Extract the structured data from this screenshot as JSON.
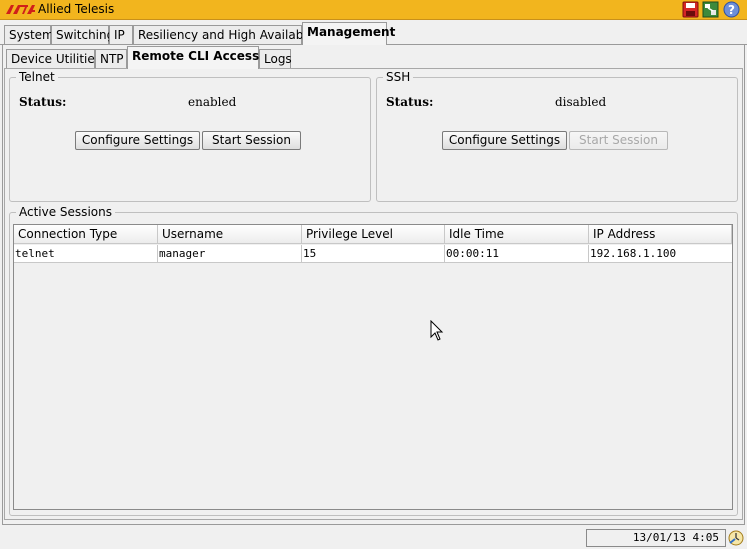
{
  "app": {
    "title": "Allied Telesis",
    "logo_text": "AT"
  },
  "main_tabs": [
    {
      "label": "System"
    },
    {
      "label": "Switching"
    },
    {
      "label": "IP"
    },
    {
      "label": "Resiliency and High Availability"
    },
    {
      "label": "Management"
    }
  ],
  "sub_tabs": [
    {
      "label": "Device Utilities"
    },
    {
      "label": "NTP"
    },
    {
      "label": "Remote CLI Access"
    },
    {
      "label": "Logs"
    }
  ],
  "telnet": {
    "title": "Telnet",
    "status_label": "Status:",
    "status_value": "enabled",
    "configure_label": "Configure Settings",
    "start_label": "Start Session"
  },
  "ssh": {
    "title": "SSH",
    "status_label": "Status:",
    "status_value": "disabled",
    "configure_label": "Configure Settings",
    "start_label": "Start Session"
  },
  "sessions": {
    "title": "Active Sessions",
    "columns": [
      "Connection Type",
      "Username",
      "Privilege Level",
      "Idle Time",
      "IP Address"
    ],
    "rows": [
      [
        "telnet",
        "manager",
        "15",
        "00:00:11",
        "192.168.1.100"
      ]
    ]
  },
  "status_bar": {
    "datetime": "13/01/13 4:05"
  },
  "colors": {
    "title_bar": "#f2b51e",
    "logo_red": "#d0201a"
  },
  "icons": [
    "save-icon",
    "network-icon",
    "help-icon",
    "clock-status-icon",
    "mouse-cursor-icon"
  ]
}
